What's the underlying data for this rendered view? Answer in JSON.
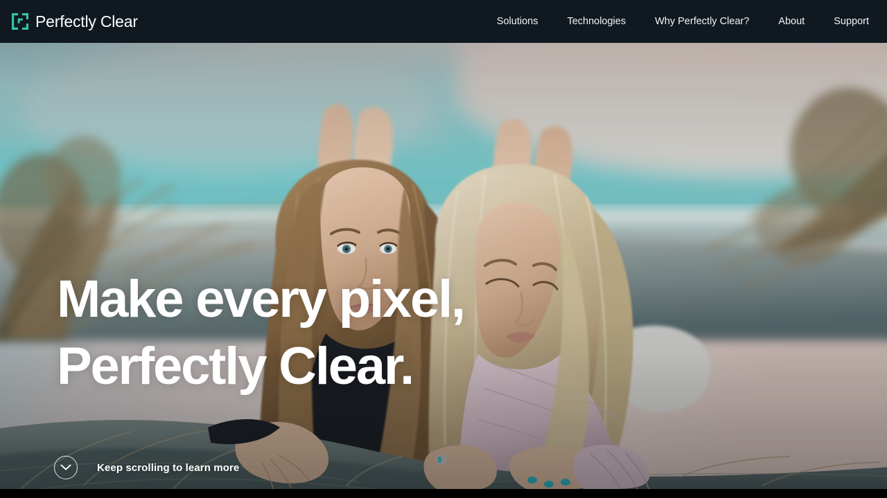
{
  "header": {
    "logo_icon": "bracket-frame-logo-icon",
    "brand_name": "Perfectly Clear",
    "brand_accent_color": "#35c3a7",
    "background_color": "#101820",
    "nav": [
      {
        "label": "Solutions"
      },
      {
        "label": "Technologies"
      },
      {
        "label": "Why Perfectly Clear?"
      },
      {
        "label": "About"
      },
      {
        "label": "Support"
      }
    ]
  },
  "hero": {
    "headline_line1": "Make every pixel,",
    "headline_line2": "Perfectly Clear.",
    "headline_color": "#ffffff",
    "scroll_cue": {
      "icon": "chevron-down-icon",
      "label": "Keep scrolling to learn more"
    },
    "photo": {
      "description": "Two young women lying on a sand dune at the beach, blurred turquoise ocean behind them",
      "ocean_color": "#7fd3d8",
      "sky_color": "#e6d7d4",
      "sand_color": "#8e9a9a",
      "grass_color": "#8d7553"
    }
  },
  "bottom_bar": {
    "color": "#000000"
  }
}
